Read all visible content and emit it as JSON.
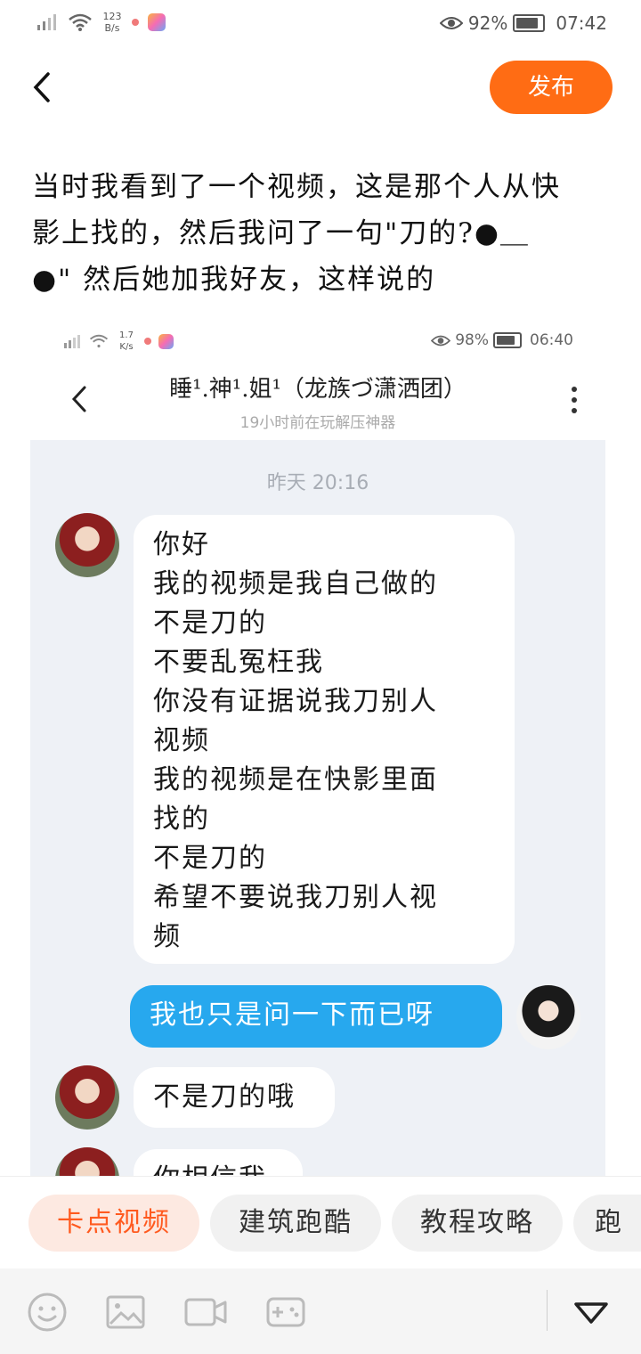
{
  "status_bar": {
    "net_speed_value": "123",
    "net_speed_unit": "B/s",
    "battery": "92%",
    "time": "07:42"
  },
  "header": {
    "publish_label": "发布"
  },
  "post": {
    "text_lines": [
      "当时我看到了一个视频，这是那个人从快",
      "影上找的，然后我问了一句\"刀的?●＿",
      "●\" 然后她加我好友，这样说的"
    ]
  },
  "embedded_screenshot": {
    "status_bar": {
      "net_speed_value": "1.7",
      "net_speed_unit": "K/s",
      "battery": "98%",
      "time": "06:40"
    },
    "chat_title": "睡¹.神¹.姐¹（龙族づ潇洒团）",
    "chat_subtitle": "19小时前在玩解压神器",
    "timestamp": "昨天 20:16",
    "messages": [
      {
        "from": "other",
        "lines": [
          "你好",
          "我的视频是我自己做的",
          "不是刀的",
          "不要乱冤枉我",
          "你没有证据说我刀别人",
          "视频",
          "我的视频是在快影里面",
          "找的",
          "不是刀的",
          "希望不要说我刀别人视",
          "频"
        ]
      },
      {
        "from": "me",
        "lines": [
          "我也只是问一下而已呀"
        ]
      },
      {
        "from": "other",
        "lines": [
          "不是刀的哦"
        ]
      },
      {
        "from": "other",
        "lines": [
          "你相信我"
        ]
      }
    ]
  },
  "tags": [
    "卡点视频",
    "建筑跑酷",
    "教程攻略",
    "跑"
  ],
  "toolbar": {
    "icons": [
      "emoji-icon",
      "image-icon",
      "video-icon",
      "game-icon",
      "collapse-icon"
    ]
  },
  "colors": {
    "accent": "#ff6c14",
    "bubble_blue": "#27a8ee",
    "chat_bg": "#eef1f6"
  }
}
